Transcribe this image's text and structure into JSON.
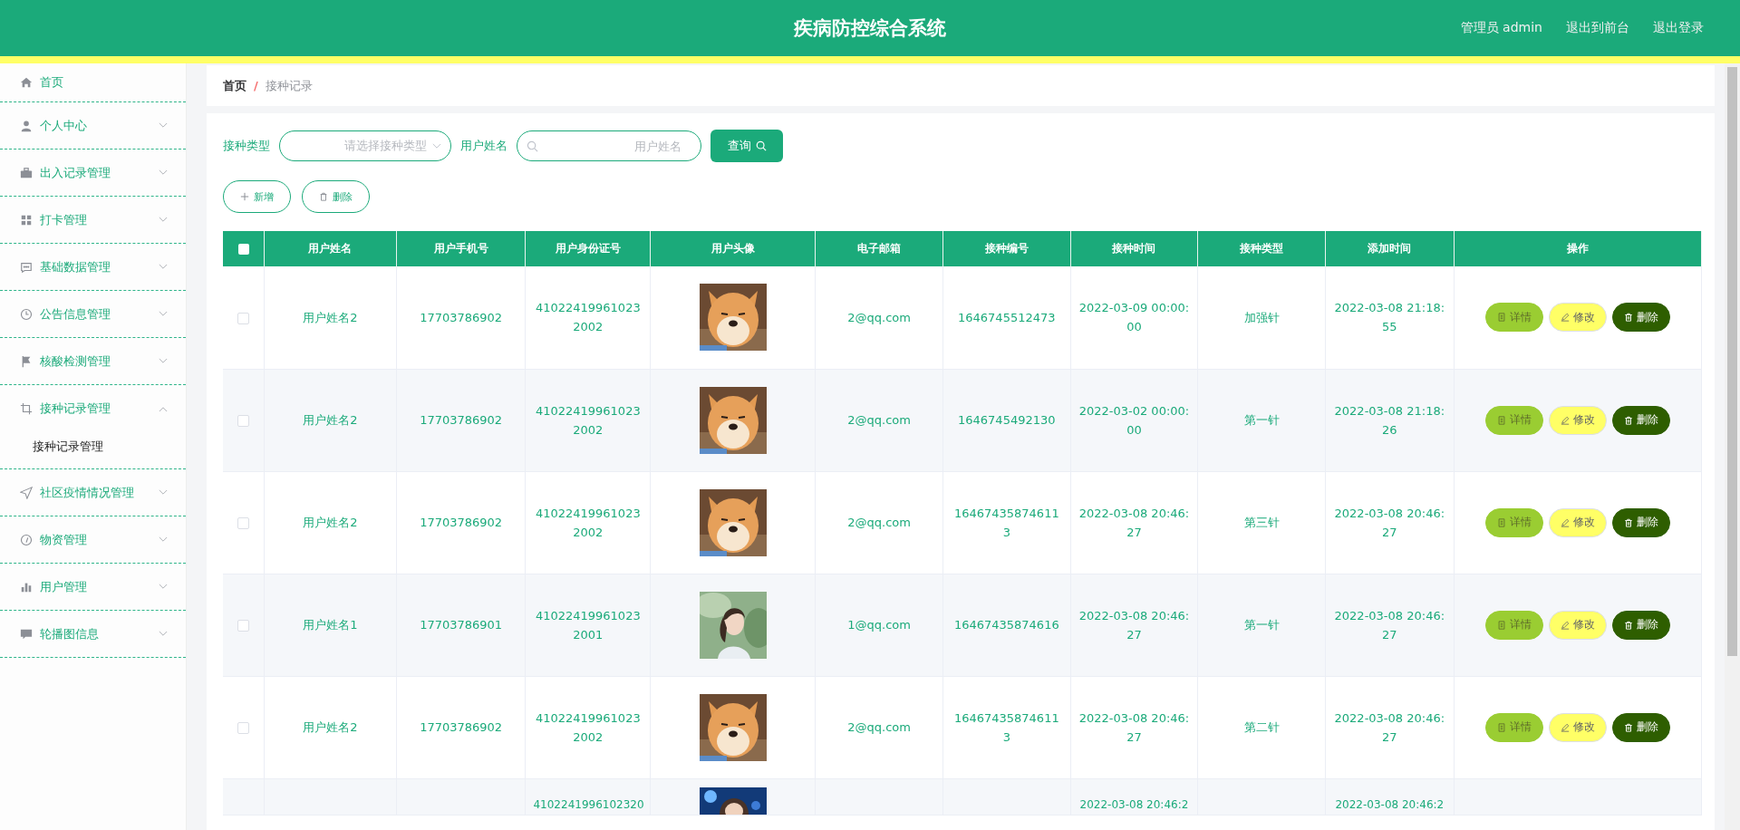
{
  "header": {
    "title": "疾病防控综合系统",
    "links": [
      "管理员 admin",
      "退出到前台",
      "退出登录"
    ]
  },
  "sidebar": {
    "items": [
      {
        "label": "首页",
        "expandable": false,
        "expanded": false
      },
      {
        "label": "个人中心",
        "expandable": true,
        "expanded": false
      },
      {
        "label": "出入记录管理",
        "expandable": true,
        "expanded": false
      },
      {
        "label": "打卡管理",
        "expandable": true,
        "expanded": false
      },
      {
        "label": "基础数据管理",
        "expandable": true,
        "expanded": false
      },
      {
        "label": "公告信息管理",
        "expandable": true,
        "expanded": false
      },
      {
        "label": "核酸检测管理",
        "expandable": true,
        "expanded": false
      },
      {
        "label": "接种记录管理",
        "expandable": true,
        "expanded": true,
        "children": [
          {
            "label": "接种记录管理"
          }
        ]
      },
      {
        "label": "社区疫情情况管理",
        "expandable": true,
        "expanded": false
      },
      {
        "label": "物资管理",
        "expandable": true,
        "expanded": false
      },
      {
        "label": "用户管理",
        "expandable": true,
        "expanded": false
      },
      {
        "label": "轮播图信息",
        "expandable": true,
        "expanded": false
      }
    ]
  },
  "breadcrumb": [
    "首页",
    "/",
    "接种记录"
  ],
  "search": {
    "type_label": "接种类型",
    "type_placeholder": "请选择接种类型",
    "name_label": "用户姓名",
    "name_placeholder": "用户姓名",
    "button": "查询"
  },
  "actions": [
    "新增",
    "删除"
  ],
  "table": {
    "header_checked": false,
    "columns": [
      "用户姓名",
      "用户手机号",
      "用户身份证号",
      "用户头像",
      "电子邮箱",
      "接种编号",
      "接种时间",
      "接种类型",
      "添加时间",
      "操作"
    ],
    "rows": [
      {
        "checked": false,
        "name": "用户姓名2",
        "phone": "17703786902",
        "id_number": "410224199610232002",
        "email": "2@qq.com",
        "number": "1646745512473",
        "time": "2022-03-09 00:00:00",
        "type": "加强针",
        "added": "2022-03-08 21:18:55",
        "buttons": [
          "详情",
          "修改",
          "删除"
        ]
      },
      {
        "checked": false,
        "name": "用户姓名2",
        "phone": "17703786902",
        "id_number": "410224199610232002",
        "email": "2@qq.com",
        "number": "1646745492130",
        "time": "2022-03-02 00:00:00",
        "type": "第一针",
        "added": "2022-03-08 21:18:26",
        "buttons": [
          "详情",
          "修改",
          "删除"
        ]
      },
      {
        "checked": false,
        "name": "用户姓名2",
        "phone": "17703786902",
        "id_number": "410224199610232002",
        "email": "2@qq.com",
        "number": "164674358746113",
        "time": "2022-03-08 20:46:27",
        "type": "第三针",
        "added": "2022-03-08 20:46:27",
        "buttons": [
          "详情",
          "修改",
          "删除"
        ]
      },
      {
        "checked": false,
        "name": "用户姓名1",
        "phone": "17703786901",
        "id_number": "410224199610232001",
        "email": "1@qq.com",
        "number": "16467435874616",
        "time": "2022-03-08 20:46:27",
        "type": "第一针",
        "added": "2022-03-08 20:46:27",
        "buttons": [
          "详情",
          "修改",
          "删除"
        ]
      },
      {
        "checked": false,
        "name": "用户姓名2",
        "phone": "17703786902",
        "id_number": "410224199610232002",
        "email": "2@qq.com",
        "number": "164674358746113",
        "time": "2022-03-08 20:46:27",
        "type": "第二针",
        "added": "2022-03-08 20:46:27",
        "buttons": [
          "详情",
          "修改",
          "删除"
        ]
      }
    ],
    "partial_row": {
      "id_number": "4102241996102320",
      "time": "2022-03-08 20:46:2",
      "added": "2022-03-08 20:46:2"
    }
  }
}
